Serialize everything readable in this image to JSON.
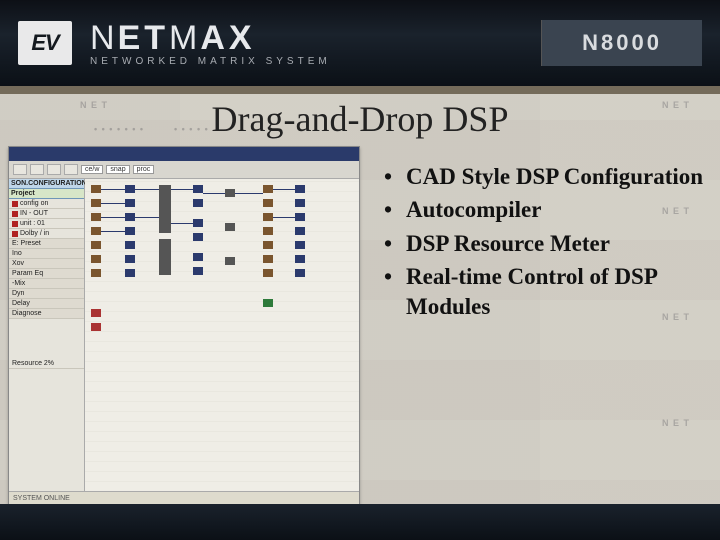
{
  "header": {
    "badge": "EV",
    "brand_thin": "N",
    "brand_bold1": "ET",
    "brand_thin2": "M",
    "brand_bold2": "AX",
    "subtitle": "NETWORKED MATRIX SYSTEM",
    "model": "N8000"
  },
  "slide": {
    "title": "Drag-and-Drop DSP"
  },
  "features": [
    "CAD Style DSP Configuration",
    "Autocompiler",
    "DSP Resource Meter",
    "Real-time Control of DSP Modules"
  ],
  "screenshot": {
    "toolbar": {
      "mode": "ce/w",
      "snap": "snap",
      "proc": "proc"
    },
    "palette": {
      "header": "SON.CONFIGURATION",
      "project_hdr": "Project",
      "items": [
        "config on",
        "IN - OUT",
        "unit : 01",
        "Dolby / in"
      ],
      "sections": [
        "E: Preset",
        "Ino",
        "Xov",
        "Param Eq",
        "-Mix",
        "Dyn",
        "Delay",
        "Diagnose"
      ],
      "resource": "Resource 2%"
    },
    "status": "SYSTEM ONLINE"
  }
}
